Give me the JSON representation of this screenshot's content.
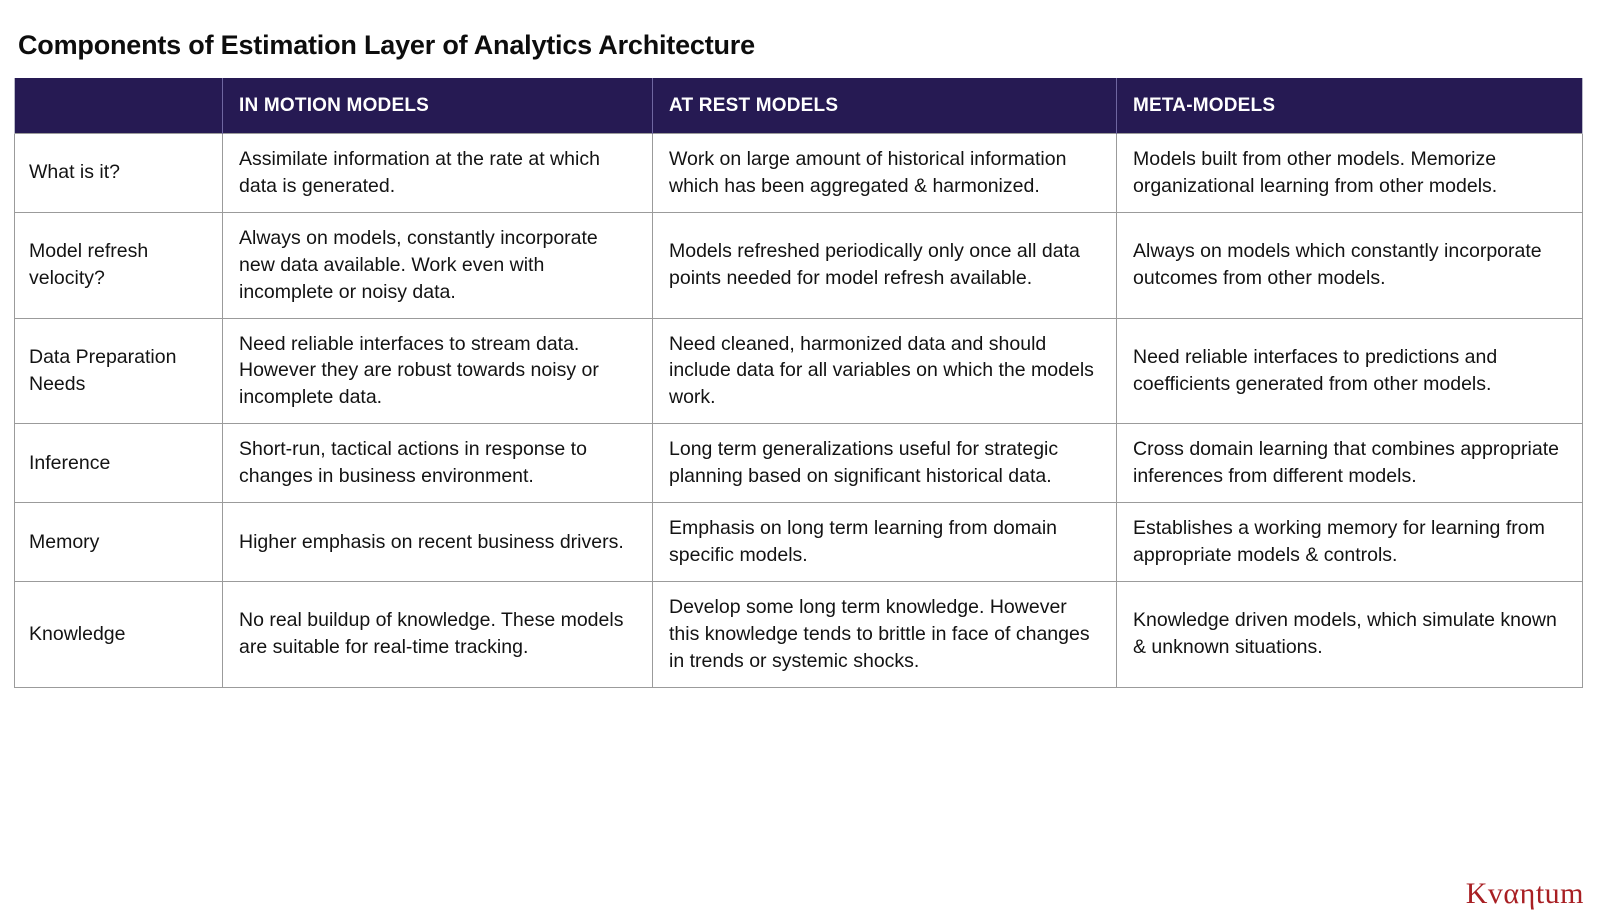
{
  "page_title": "Components of Estimation Layer of Analytics Architecture",
  "brand": {
    "logo_text": "Κvαηtum",
    "logo_color": "#a81f23"
  },
  "theme": {
    "header_bg": "#261a53",
    "header_text": "#ffffff",
    "grid_line": "#9b9b9b",
    "body_text": "#131313"
  },
  "table": {
    "columns": [
      {
        "key": "label",
        "header": ""
      },
      {
        "key": "in_motion",
        "header": "IN MOTION MODELS"
      },
      {
        "key": "at_rest",
        "header": "AT REST MODELS"
      },
      {
        "key": "meta",
        "header": "META-MODELS"
      }
    ],
    "rows": [
      {
        "label": "What is it?",
        "in_motion": "Assimilate information at the rate at which data is generated.",
        "at_rest": "Work on large amount of historical information which has been aggregated & harmonized.",
        "meta": "Models built from other models. Memorize organizational learning from other models."
      },
      {
        "label": "Model refresh velocity?",
        "in_motion": "Always on models, constantly incorporate new data available. Work even with incomplete or noisy data.",
        "at_rest": "Models refreshed periodically only once all data points needed for model refresh available.",
        "meta": "Always on models which constantly incorporate outcomes from other models."
      },
      {
        "label": "Data Preparation Needs",
        "in_motion": "Need reliable interfaces to stream data. However they are robust towards noisy or incomplete data.",
        "at_rest": "Need cleaned, harmonized data and should include data for all variables on which the models work.",
        "meta": "Need reliable interfaces to predictions and coefficients generated from other models."
      },
      {
        "label": "Inference",
        "in_motion": "Short-run, tactical actions in response to changes in business environment.",
        "at_rest": " Long term generalizations useful for strategic planning based on significant historical data.",
        "meta": "Cross domain learning that combines appropriate inferences from different models."
      },
      {
        "label": "Memory",
        "in_motion": "Higher emphasis on recent business drivers.",
        "at_rest": "Emphasis on long term learning from domain specific models.",
        "meta": "Establishes a working memory for learning from appropriate models & controls."
      },
      {
        "label": "Knowledge",
        "in_motion": "No real buildup of knowledge. These models are suitable for real-time tracking.",
        "at_rest": "Develop some long term knowledge. However this knowledge tends to brittle in face of changes in trends or systemic shocks.",
        "meta": "Knowledge driven models, which simulate known & unknown situations."
      }
    ]
  }
}
